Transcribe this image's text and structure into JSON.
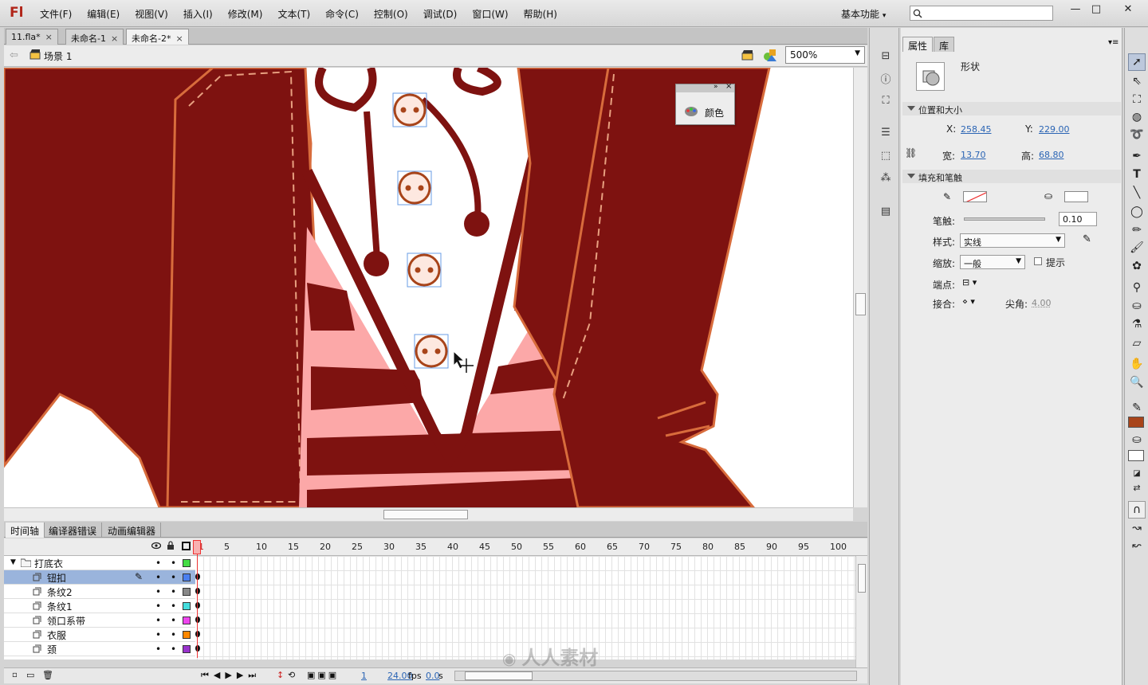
{
  "app": {
    "logo": "Fl"
  },
  "menu": [
    "文件(F)",
    "编辑(E)",
    "视图(V)",
    "插入(I)",
    "修改(M)",
    "文本(T)",
    "命令(C)",
    "控制(O)",
    "调试(D)",
    "窗口(W)",
    "帮助(H)"
  ],
  "workspace": "基本功能",
  "doc_tabs": [
    {
      "label": "11.fla*",
      "active": false
    },
    {
      "label": "未命名-1",
      "active": false
    },
    {
      "label": "未命名-2*",
      "active": true
    }
  ],
  "edit_bar": {
    "scene": "场景 1",
    "zoom": "500%"
  },
  "color_panel": {
    "label": "颜色"
  },
  "timeline": {
    "tabs": [
      {
        "label": "时间轴",
        "active": true
      },
      {
        "label": "编译器错误",
        "active": false
      },
      {
        "label": "动画编辑器",
        "active": false
      }
    ],
    "frame_numbers": [
      "1",
      "5",
      "10",
      "15",
      "20",
      "25",
      "30",
      "35",
      "40",
      "45",
      "50",
      "55",
      "60",
      "65",
      "70",
      "75",
      "80",
      "85",
      "90",
      "95",
      "100"
    ],
    "folder": {
      "name": "打底衣",
      "color": "#44dd44"
    },
    "layers": [
      {
        "name": "钮扣",
        "color": "#4a7ff0",
        "selected": true
      },
      {
        "name": "条纹2",
        "color": "#888888",
        "selected": false
      },
      {
        "name": "条纹1",
        "color": "#44dddd",
        "selected": false
      },
      {
        "name": "领口系带",
        "color": "#ee44ee",
        "selected": false
      },
      {
        "name": "衣服",
        "color": "#ff8800",
        "selected": false
      },
      {
        "name": "颈",
        "color": "#9933cc",
        "selected": false
      }
    ],
    "footer": {
      "frame": "1",
      "fps": "24.00",
      "fps_unit": "fps",
      "time": "0.0",
      "time_unit": "s"
    }
  },
  "properties": {
    "tabs": [
      {
        "label": "属性",
        "active": true
      },
      {
        "label": "库",
        "active": false
      }
    ],
    "type": "形状",
    "pos_section": "位置和大小",
    "x_label": "X:",
    "x": "258.45",
    "y_label": "Y:",
    "y": "229.00",
    "w_label": "宽:",
    "w": "13.70",
    "h_label": "高:",
    "h": "68.80",
    "fill_section": "填充和笔触",
    "stroke_label": "笔触:",
    "stroke": "0.10",
    "style_label": "样式:",
    "style": "实线",
    "scale_label": "缩放:",
    "scale": "一般",
    "hint_label": "提示",
    "cap_label": "端点:",
    "join_label": "接合:",
    "miter_label": "尖角:",
    "miter": "4.00"
  },
  "colors": {
    "stroke_swatch": "#a8441a",
    "fill_swatch": "#ffffff",
    "jacket": "#7e1210",
    "outline": "#d86c3c",
    "stripe": "#fca8a8",
    "accent": "#2a64b4"
  },
  "watermark": "人人素材"
}
